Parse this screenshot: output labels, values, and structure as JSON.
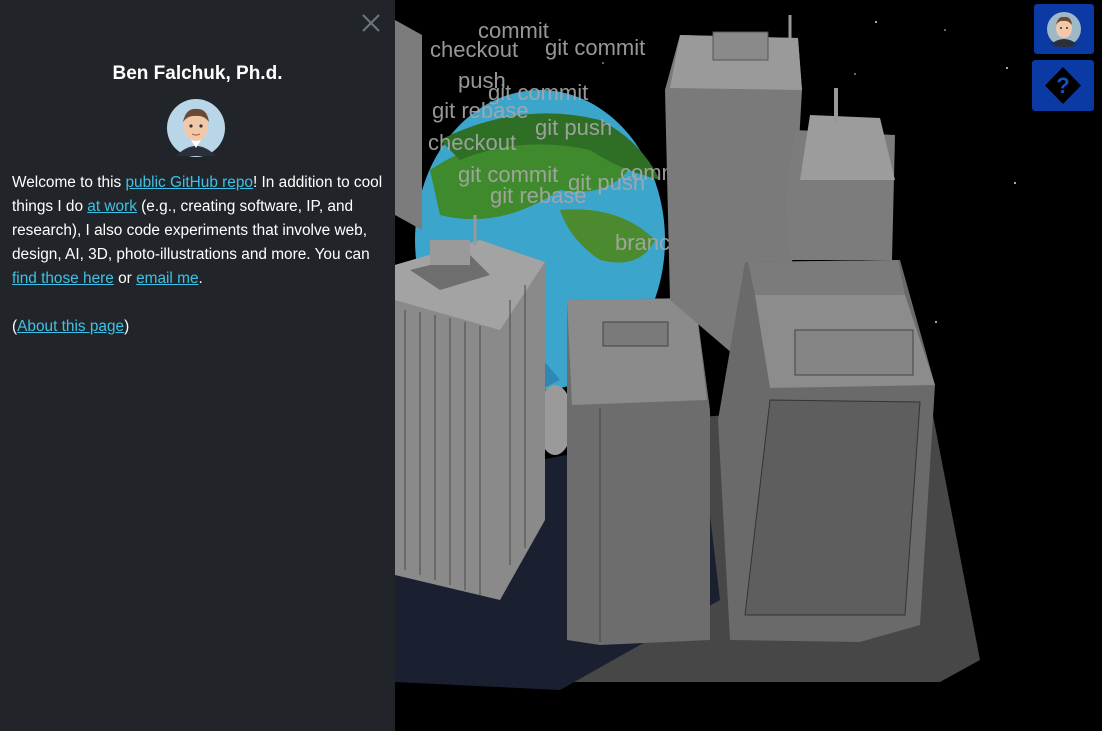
{
  "panel": {
    "title": "Ben Falchuk, Ph.d.",
    "intro": {
      "t1": "Welcome to this ",
      "link_repo": "public GitHub repo",
      "t2": "! In addition to cool things I do ",
      "link_work": "at work",
      "t3": " (e.g., creating software, IP, and research), I also code experiments that involve web, design, AI, 3D, photo-illustrations and more. You can ",
      "link_find": "find those here",
      "t4": " or ",
      "link_email": "email me",
      "t5": "."
    },
    "about": {
      "open": "(",
      "link": "About this page",
      "close": ")"
    }
  },
  "scene": {
    "git_words": [
      "commit",
      "checkout",
      "git commit",
      "push",
      "git commit",
      "git rebase",
      "git push",
      "checkout",
      "git commit",
      "git push",
      "git rebase",
      "commit",
      "branch"
    ]
  },
  "colors": {
    "panel_bg": "#212529",
    "link": "#3fc1e6",
    "button_bg": "#0b3aa5",
    "scene_bg": "#000000"
  },
  "icons": {
    "close": "close-icon",
    "profile": "avatar-icon",
    "help": "question-mark-icon"
  }
}
